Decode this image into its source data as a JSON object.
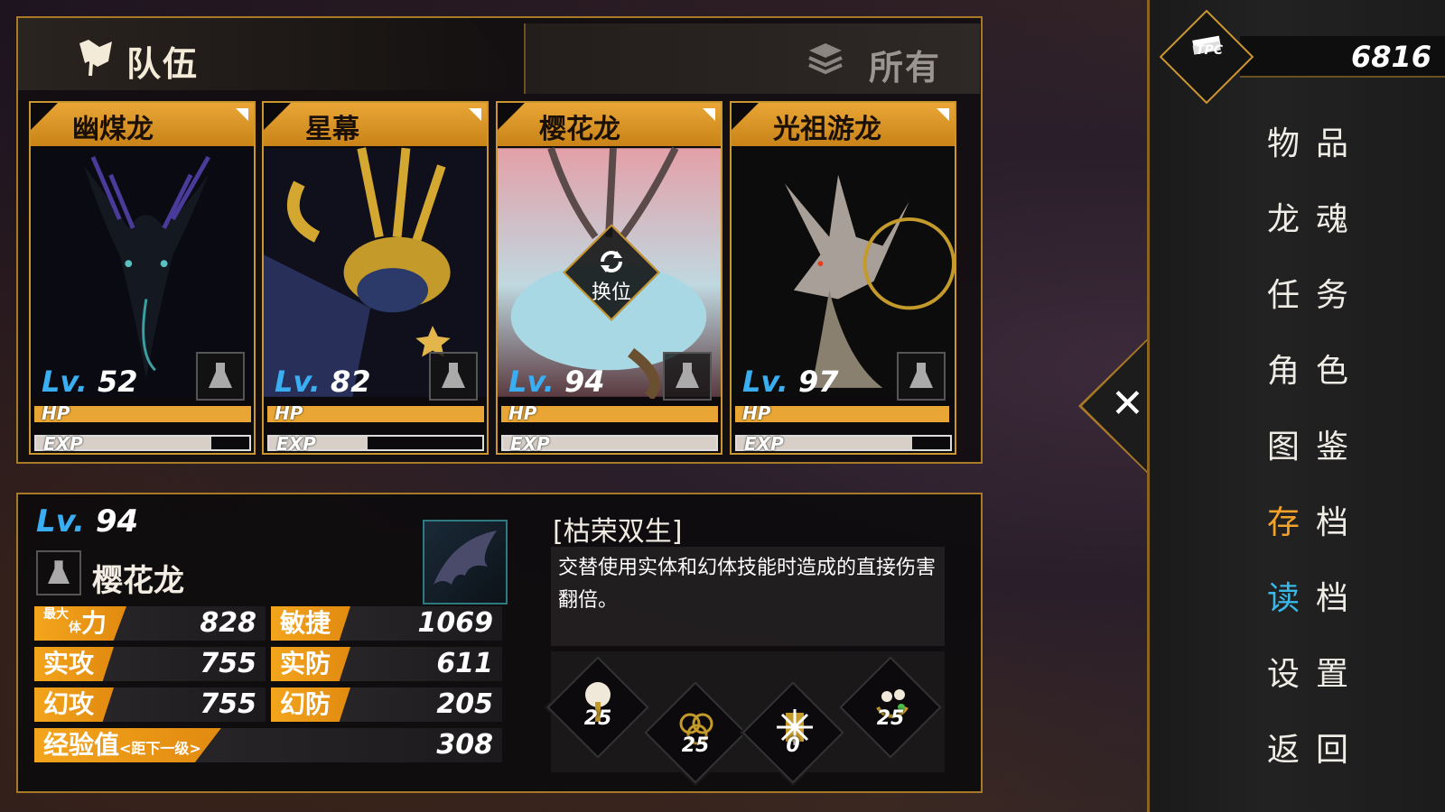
{
  "team": {
    "title": "队伍",
    "all_label": "所有",
    "swap_label": "换位",
    "cards": [
      {
        "name": "幽煤龙",
        "lv_prefix": "Lv.",
        "level": "52",
        "hp_label": "HP",
        "exp_label": "EXP",
        "hp": 1.0,
        "exp": 0.82
      },
      {
        "name": "星幕",
        "lv_prefix": "Lv.",
        "level": "82",
        "hp_label": "HP",
        "exp_label": "EXP",
        "hp": 1.0,
        "exp": 0.5
      },
      {
        "name": "樱花龙",
        "lv_prefix": "Lv.",
        "level": "94",
        "hp_label": "HP",
        "exp_label": "EXP",
        "hp": 1.0,
        "exp": 1.0
      },
      {
        "name": "光祖游龙",
        "lv_prefix": "Lv.",
        "level": "97",
        "hp_label": "HP",
        "exp_label": "EXP",
        "hp": 0.99,
        "exp": 0.82
      }
    ]
  },
  "detail": {
    "lv_prefix": "Lv.",
    "level": "94",
    "name": "樱花龙",
    "stats": {
      "max_hp_label_small": "最大",
      "max_hp_label_small2": "体",
      "max_hp_label_big": "力",
      "max_hp": "828",
      "agility_label": "敏捷",
      "agility": "1069",
      "phys_atk_label": "实攻",
      "phys_atk": "755",
      "phys_def_label": "实防",
      "phys_def": "611",
      "phantom_atk_label": "幻攻",
      "phantom_atk": "755",
      "phantom_def_label": "幻防",
      "phantom_def": "205",
      "exp_label": "经验值",
      "exp_sub": "<距下一级>",
      "exp_value": "308"
    },
    "skill_title": "[枯荣双生]",
    "skill_desc": "交替使用实体和幻体技能时造成的直接伤害翻倍。",
    "skill_levels": [
      "25",
      "25",
      "0",
      "25"
    ]
  },
  "sidebar": {
    "currency_label": "TPC",
    "currency": "6816",
    "menu": [
      "物品",
      "龙魂",
      "任务",
      "角色",
      "图鉴",
      "存档",
      "读档",
      "设置",
      "返回"
    ],
    "colors": {
      "save": "#f2a22a",
      "load": "#3ab8e8",
      "default": "#f0ece6"
    }
  },
  "colors": {
    "gold": "#c9962f",
    "accent_orange": "#e9a635",
    "lv_blue": "#3aaef2"
  }
}
